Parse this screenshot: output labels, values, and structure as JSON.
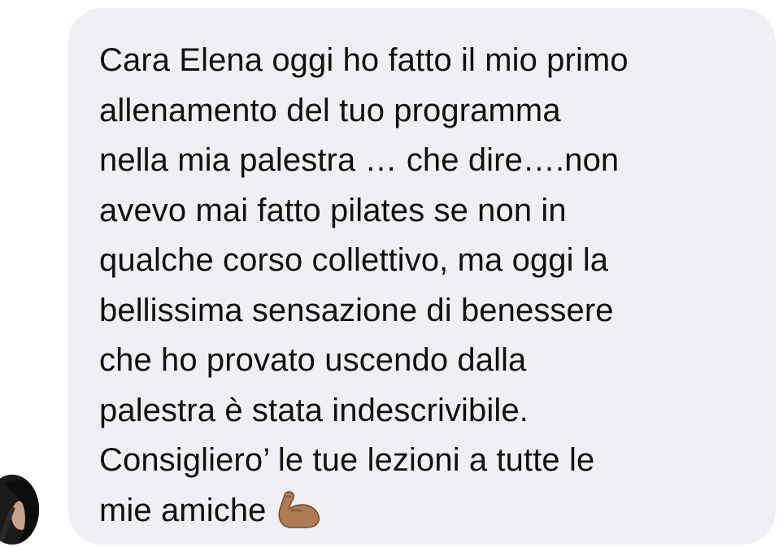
{
  "message": {
    "lines": [
      "Cara Elena oggi ho fatto il mio primo",
      "allenamento del tuo programma",
      "nella mia palestra … che dire….non",
      "avevo mai fatto pilates se non in",
      "qualche corso collettivo, ma oggi la",
      "bellissima sensazione di benessere",
      "che ho provato uscendo dalla",
      "palestra è stata indescrivibile.",
      "Consigliero’ le tue lezioni a tutte le",
      "mie amiche"
    ],
    "emoji": "flexed-biceps-icon"
  },
  "colors": {
    "bubble_background": "#f0f0f4",
    "text": "#111111",
    "emoji_skin": "#b07a52"
  }
}
